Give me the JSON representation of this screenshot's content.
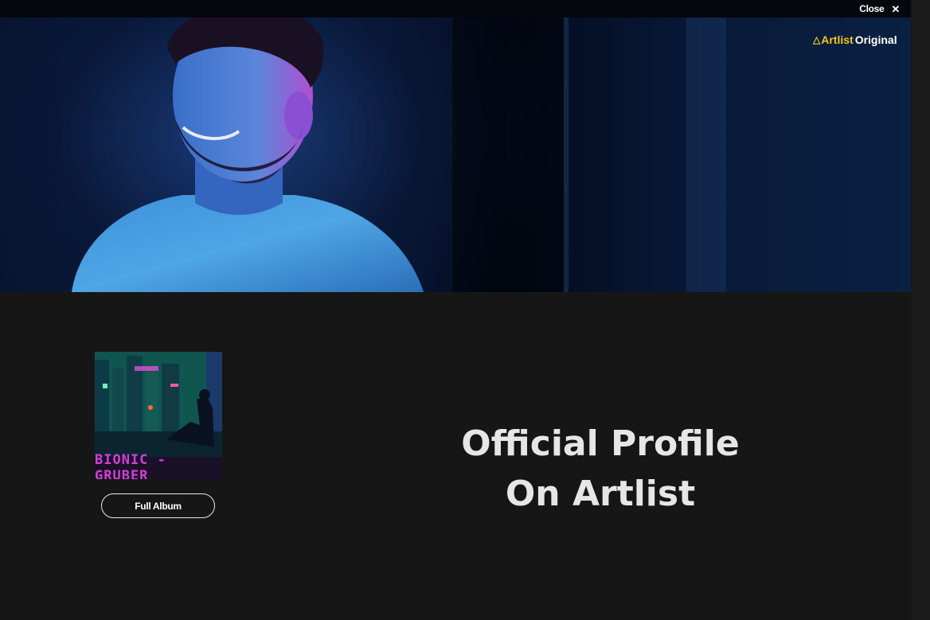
{
  "window": {
    "close_label": "Close",
    "close_icon": "close-icon"
  },
  "brand": {
    "artlist": "Artlist",
    "original": "Original",
    "accent_color": "#f5c518"
  },
  "album": {
    "cover_text": "BIONIC - GRUBER",
    "full_album_label": "Full Album"
  },
  "headline": {
    "line1": "Official Profile",
    "line2": "On Artlist"
  },
  "colors": {
    "page_background": "#161616",
    "hero_tint": "#1b3b7a",
    "text": "#e6e6e6"
  }
}
